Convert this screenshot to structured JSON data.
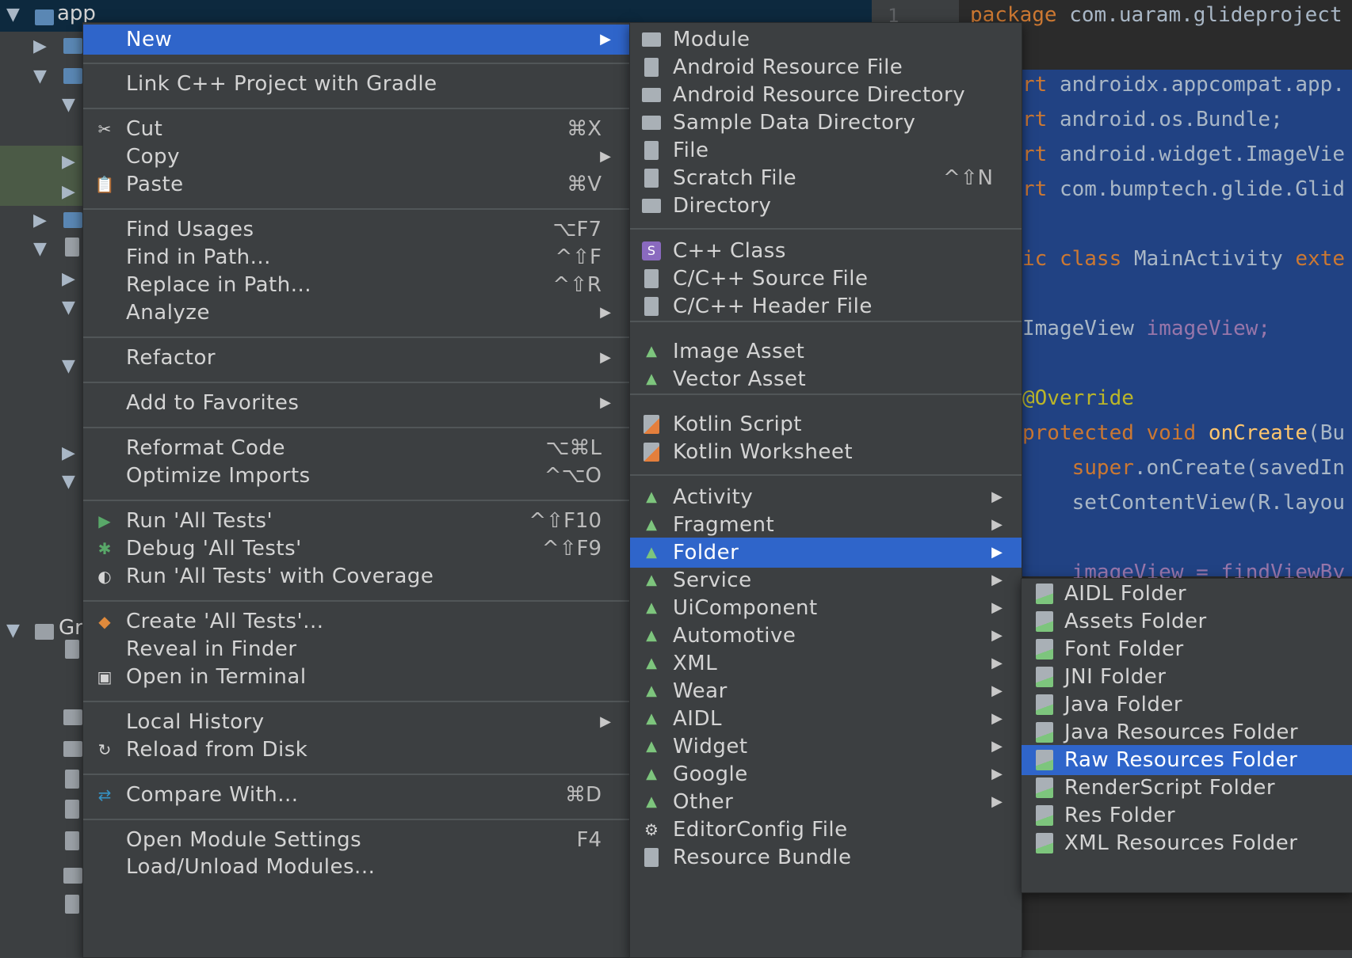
{
  "project_tree": {
    "root_label": "app",
    "gradle_label": "Gr",
    "line_number": "1"
  },
  "editor": {
    "lines": [
      {
        "kind": "kw",
        "text": "package",
        "rest": " com.uaram.glideproject"
      },
      {
        "kind": "kw",
        "text": "rt",
        "rest": " androidx.appcompat.app."
      },
      {
        "kind": "kw",
        "text": "rt",
        "rest": " android.os.Bundle;"
      },
      {
        "kind": "kw",
        "text": "rt",
        "rest": " android.widget.ImageVie"
      },
      {
        "kind": "kw",
        "text": "rt",
        "rest": " com.bumptech.glide.Glid"
      },
      {
        "kind": "kw",
        "text": "ic class",
        "rest": " MainActivity ",
        "tail": "exte"
      },
      {
        "kind": "pl",
        "text": "ImageView ",
        "rest": "imageView;"
      },
      {
        "kind": "an",
        "text": "@Override",
        "rest": ""
      },
      {
        "kind": "kw",
        "text": "protected void ",
        "rest": "onCreate",
        "tail": "(Bu"
      },
      {
        "kind": "kw",
        "text": "    super",
        "rest": ".onCreate(savedIn"
      },
      {
        "kind": "pl",
        "text": "    setContentView(R.layou",
        "rest": ""
      },
      {
        "kind": "pl",
        "text": "    imageView = findViewBy",
        "rest": ""
      }
    ]
  },
  "context_menu": {
    "items": [
      {
        "label": "New",
        "shortcut": "",
        "submenu": true,
        "selected": true,
        "icon": ""
      },
      {
        "label": "Link C++ Project with Gradle",
        "shortcut": "",
        "submenu": false,
        "icon": ""
      },
      {
        "label": "Cut",
        "shortcut": "⌘X",
        "submenu": false,
        "icon": "scissors-icon"
      },
      {
        "label": "Copy",
        "shortcut": "",
        "submenu": true,
        "icon": ""
      },
      {
        "label": "Paste",
        "shortcut": "⌘V",
        "submenu": false,
        "icon": "clipboard-icon"
      },
      {
        "label": "Find Usages",
        "shortcut": "⌥F7",
        "submenu": false,
        "icon": ""
      },
      {
        "label": "Find in Path...",
        "shortcut": "^⇧F",
        "submenu": false,
        "icon": ""
      },
      {
        "label": "Replace in Path...",
        "shortcut": "^⇧R",
        "submenu": false,
        "icon": ""
      },
      {
        "label": "Analyze",
        "shortcut": "",
        "submenu": true,
        "icon": ""
      },
      {
        "label": "Refactor",
        "shortcut": "",
        "submenu": true,
        "icon": ""
      },
      {
        "label": "Add to Favorites",
        "shortcut": "",
        "submenu": true,
        "icon": ""
      },
      {
        "label": "Reformat Code",
        "shortcut": "⌥⌘L",
        "submenu": false,
        "icon": ""
      },
      {
        "label": "Optimize Imports",
        "shortcut": "^⌥O",
        "submenu": false,
        "icon": ""
      },
      {
        "label": "Run 'All Tests'",
        "shortcut": "^⇧F10",
        "submenu": false,
        "icon": "run-icon"
      },
      {
        "label": "Debug 'All Tests'",
        "shortcut": "^⇧F9",
        "submenu": false,
        "icon": "debug-icon"
      },
      {
        "label": "Run 'All Tests' with Coverage",
        "shortcut": "",
        "submenu": false,
        "icon": "coverage-icon"
      },
      {
        "label": "Create 'All Tests'...",
        "shortcut": "",
        "submenu": false,
        "icon": "create-test-icon"
      },
      {
        "label": "Reveal in Finder",
        "shortcut": "",
        "submenu": false,
        "icon": ""
      },
      {
        "label": "Open in Terminal",
        "shortcut": "",
        "submenu": false,
        "icon": "terminal-icon"
      },
      {
        "label": "Local History",
        "shortcut": "",
        "submenu": true,
        "icon": ""
      },
      {
        "label": "Reload from Disk",
        "shortcut": "",
        "submenu": false,
        "icon": "reload-icon"
      },
      {
        "label": "Compare With...",
        "shortcut": "⌘D",
        "submenu": false,
        "icon": "compare-icon"
      },
      {
        "label": "Open Module Settings",
        "shortcut": "F4",
        "submenu": false,
        "icon": ""
      },
      {
        "label": "Load/Unload Modules...",
        "shortcut": "",
        "submenu": false,
        "icon": ""
      }
    ]
  },
  "new_menu": {
    "items": [
      {
        "label": "Module",
        "shortcut": "",
        "submenu": false,
        "icon": "module-icon"
      },
      {
        "label": "Android Resource File",
        "shortcut": "",
        "submenu": false,
        "icon": "resource-file-icon"
      },
      {
        "label": "Android Resource Directory",
        "shortcut": "",
        "submenu": false,
        "icon": "folder-icon"
      },
      {
        "label": "Sample Data Directory",
        "shortcut": "",
        "submenu": false,
        "icon": "folder-icon"
      },
      {
        "label": "File",
        "shortcut": "",
        "submenu": false,
        "icon": "file-icon"
      },
      {
        "label": "Scratch File",
        "shortcut": "^⇧N",
        "submenu": false,
        "icon": "scratch-file-icon"
      },
      {
        "label": "Directory",
        "shortcut": "",
        "submenu": false,
        "icon": "folder-icon"
      },
      {
        "label": "C++ Class",
        "shortcut": "",
        "submenu": false,
        "icon": "cpp-class-icon"
      },
      {
        "label": "C/C++ Source File",
        "shortcut": "",
        "submenu": false,
        "icon": "cpp-source-icon"
      },
      {
        "label": "C/C++ Header File",
        "shortcut": "",
        "submenu": false,
        "icon": "cpp-header-icon"
      },
      {
        "label": "Image Asset",
        "shortcut": "",
        "submenu": false,
        "icon": "android-icon"
      },
      {
        "label": "Vector Asset",
        "shortcut": "",
        "submenu": false,
        "icon": "android-icon"
      },
      {
        "label": "Kotlin Script",
        "shortcut": "",
        "submenu": false,
        "icon": "kotlin-icon"
      },
      {
        "label": "Kotlin Worksheet",
        "shortcut": "",
        "submenu": false,
        "icon": "kotlin-icon"
      },
      {
        "label": "Activity",
        "shortcut": "",
        "submenu": true,
        "icon": "android-icon"
      },
      {
        "label": "Fragment",
        "shortcut": "",
        "submenu": true,
        "icon": "android-icon"
      },
      {
        "label": "Folder",
        "shortcut": "",
        "submenu": true,
        "selected": true,
        "icon": "android-icon"
      },
      {
        "label": "Service",
        "shortcut": "",
        "submenu": true,
        "icon": "android-icon"
      },
      {
        "label": "UiComponent",
        "shortcut": "",
        "submenu": true,
        "icon": "android-icon"
      },
      {
        "label": "Automotive",
        "shortcut": "",
        "submenu": true,
        "icon": "android-icon"
      },
      {
        "label": "XML",
        "shortcut": "",
        "submenu": true,
        "icon": "android-icon"
      },
      {
        "label": "Wear",
        "shortcut": "",
        "submenu": true,
        "icon": "android-icon"
      },
      {
        "label": "AIDL",
        "shortcut": "",
        "submenu": true,
        "icon": "android-icon"
      },
      {
        "label": "Widget",
        "shortcut": "",
        "submenu": true,
        "icon": "android-icon"
      },
      {
        "label": "Google",
        "shortcut": "",
        "submenu": true,
        "icon": "android-icon"
      },
      {
        "label": "Other",
        "shortcut": "",
        "submenu": true,
        "icon": "android-icon"
      },
      {
        "label": "EditorConfig File",
        "shortcut": "",
        "submenu": false,
        "icon": "gear-icon"
      },
      {
        "label": "Resource Bundle",
        "shortcut": "",
        "submenu": false,
        "icon": "resource-bundle-icon"
      }
    ]
  },
  "folder_menu": {
    "items": [
      {
        "label": "AIDL Folder"
      },
      {
        "label": "Assets Folder"
      },
      {
        "label": "Font Folder"
      },
      {
        "label": "JNI Folder"
      },
      {
        "label": "Java Folder"
      },
      {
        "label": "Java Resources Folder"
      },
      {
        "label": "Raw Resources Folder",
        "selected": true
      },
      {
        "label": "RenderScript Folder"
      },
      {
        "label": "Res Folder"
      },
      {
        "label": "XML Resources Folder"
      }
    ]
  },
  "colors": {
    "menu_bg": "#3c3f41",
    "selection": "#2f65ca",
    "editor_selection": "#214283",
    "android_green": "#7dc57d"
  }
}
